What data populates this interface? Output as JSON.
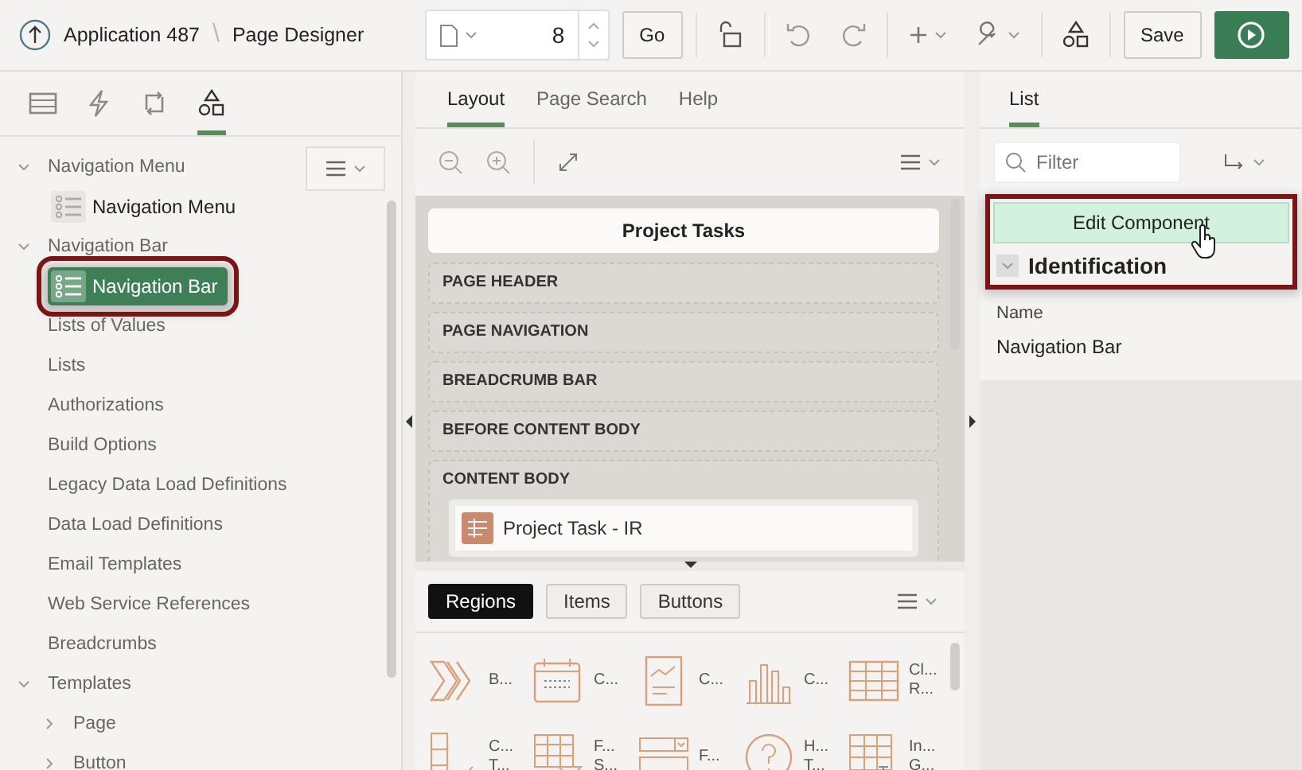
{
  "header": {
    "app_link": "Application 487",
    "separator": "\\",
    "page_title": "Page Designer",
    "page_number": "8",
    "go_label": "Go",
    "save_label": "Save"
  },
  "left_panel": {
    "icon_tabs": [
      {
        "kind": "rendering",
        "selected": false
      },
      {
        "kind": "dynamic",
        "selected": false
      },
      {
        "kind": "processing",
        "selected": false
      },
      {
        "kind": "shared",
        "selected": true
      }
    ],
    "tree": [
      {
        "label": "Navigation Menu",
        "expanded": true,
        "children": [
          {
            "label": "Navigation Menu",
            "selected": false,
            "highlighted": false
          }
        ]
      },
      {
        "label": "Navigation Bar",
        "expanded": true,
        "children": [
          {
            "label": "Navigation Bar",
            "selected": true,
            "highlighted": true
          }
        ]
      },
      {
        "label": "Lists of Values"
      },
      {
        "label": "Lists"
      },
      {
        "label": "Authorizations"
      },
      {
        "label": "Build Options"
      },
      {
        "label": "Legacy Data Load Definitions"
      },
      {
        "label": "Data Load Definitions"
      },
      {
        "label": "Email Templates"
      },
      {
        "label": "Web Service References"
      },
      {
        "label": "Breadcrumbs"
      },
      {
        "label": "Templates",
        "expanded": true,
        "children": [
          {
            "label": "Page",
            "expanded": false
          },
          {
            "label": "Button",
            "expanded": false
          }
        ]
      }
    ]
  },
  "middle_panel": {
    "tabs": [
      {
        "label": "Layout",
        "selected": true
      },
      {
        "label": "Page Search",
        "selected": false
      },
      {
        "label": "Help",
        "selected": false
      }
    ],
    "page_title": "Project Tasks",
    "regions": [
      {
        "label": "PAGE HEADER"
      },
      {
        "label": "PAGE NAVIGATION"
      },
      {
        "label": "BREADCRUMB BAR"
      },
      {
        "label": "BEFORE CONTENT BODY"
      },
      {
        "label": "CONTENT BODY",
        "components": [
          "Project Task - IR"
        ]
      }
    ],
    "gallery_tabs": [
      {
        "label": "Regions",
        "selected": true
      },
      {
        "label": "Items",
        "selected": false
      },
      {
        "label": "Buttons",
        "selected": false
      }
    ],
    "gallery": [
      {
        "kind": "chevrons",
        "lines": [
          "B..."
        ]
      },
      {
        "kind": "calendar",
        "lines": [
          "C..."
        ]
      },
      {
        "kind": "chart-doc",
        "lines": [
          "C..."
        ]
      },
      {
        "kind": "bars",
        "lines": [
          "C..."
        ]
      },
      {
        "kind": "grid",
        "lines": [
          "Cl...",
          "R..."
        ]
      },
      {
        "kind": "checklist",
        "lines": [
          "C...",
          "T..."
        ]
      },
      {
        "kind": "filter-grid",
        "lines": [
          "F...",
          "S..."
        ]
      },
      {
        "kind": "form",
        "lines": [
          "F..."
        ]
      },
      {
        "kind": "help",
        "lines": [
          "H...",
          "T..."
        ]
      },
      {
        "kind": "edit-grid",
        "lines": [
          "In...",
          "G..."
        ]
      }
    ]
  },
  "right_panel": {
    "tabs": [
      {
        "label": "List",
        "selected": true
      }
    ],
    "filter": {
      "placeholder": "Filter"
    },
    "callout": {
      "highlighted": true,
      "button": "Edit Component",
      "section": "Identification"
    },
    "fields": [
      {
        "label": "Name",
        "value": "Navigation Bar"
      }
    ]
  }
}
